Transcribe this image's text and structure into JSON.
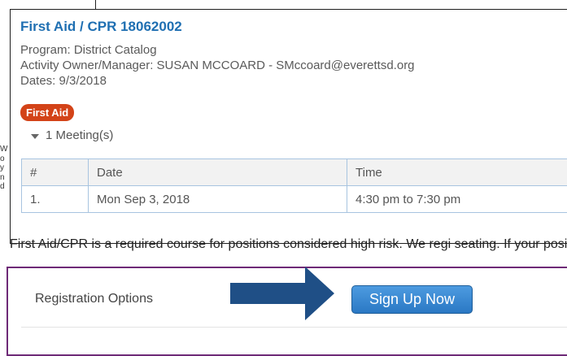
{
  "background": {
    "left_edge_text": [
      "W",
      "o",
      "y",
      "n",
      "d"
    ]
  },
  "activity": {
    "title": "First Aid / CPR 18062002",
    "program": "Program: District Catalog",
    "owner": "Activity Owner/Manager: SUSAN MCCOARD  - SMccoard@everettsd.org",
    "dates": "Dates: 9/3/2018",
    "badge": "First Aid",
    "meetings_toggle": "1 Meeting(s)",
    "meetings": {
      "headers": [
        "#",
        "Date",
        "Time"
      ],
      "rows": [
        [
          "1.",
          "Mon Sep 3, 2018",
          "4:30 pm to 7:30 pm"
        ]
      ]
    },
    "description": "First Aid/CPR is a required course for positions considered high risk. We regi seating. If your position is not required to have First Aid/CPR certification you"
  },
  "registration": {
    "label": "Registration Options",
    "signup_button": "Sign Up Now"
  },
  "colors": {
    "title_blue": "#1f6fb2",
    "badge_red": "#d34318",
    "arrow_navy": "#1f4f86",
    "panel_border_purple": "#6e2a77",
    "button_blue": "#2a78c4"
  }
}
